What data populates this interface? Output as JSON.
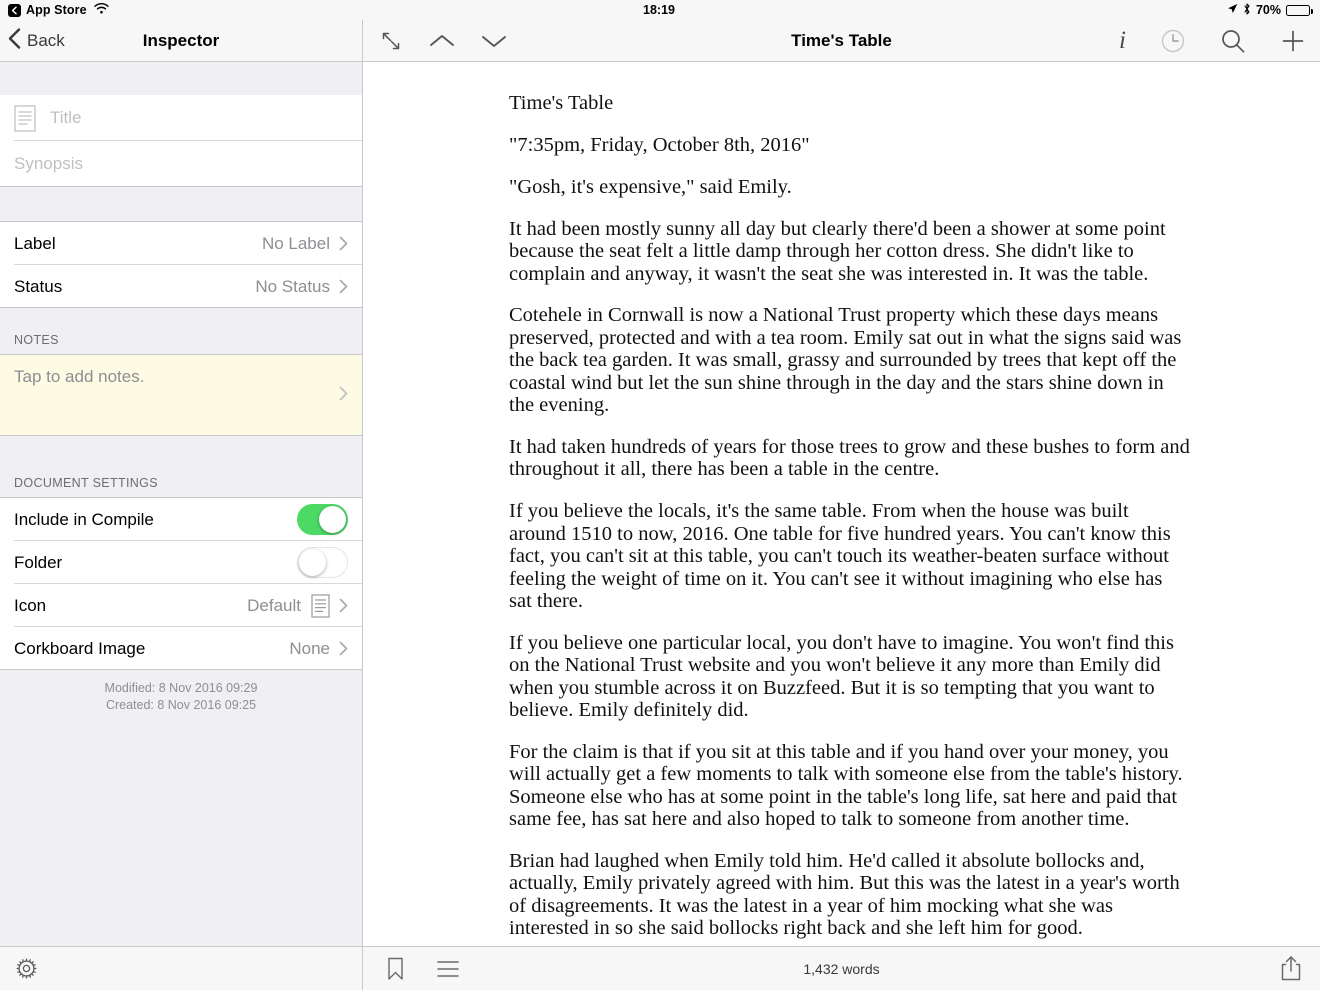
{
  "statusbar": {
    "back_app": "App Store",
    "wifi_icon": "wifi-icon",
    "time": "18:19",
    "location_icon": "location-arrow-icon",
    "bluetooth_icon": "bluetooth-icon",
    "battery_percent": "70%",
    "battery_level": 70
  },
  "sidebar": {
    "nav": {
      "back_label": "Back",
      "title": "Inspector"
    },
    "title_field": {
      "placeholder": "Title",
      "value": "",
      "icon": "document-lines-icon"
    },
    "synopsis_field": {
      "placeholder": "Synopsis",
      "value": ""
    },
    "meta_rows": [
      {
        "label": "Label",
        "value": "No Label"
      },
      {
        "label": "Status",
        "value": "No Status"
      }
    ],
    "notes": {
      "header": "NOTES",
      "placeholder": "Tap to add notes."
    },
    "document_settings": {
      "header": "DOCUMENT SETTINGS",
      "include_in_compile": {
        "label": "Include in Compile",
        "on": true
      },
      "folder": {
        "label": "Folder",
        "on": false
      },
      "icon_row": {
        "label": "Icon",
        "value": "Default",
        "icon": "document-lines-icon"
      },
      "corkboard_row": {
        "label": "Corkboard Image",
        "value": "None"
      }
    },
    "footer": {
      "modified": "Modified: 8 Nov 2016  09:29",
      "created": "Created: 8 Nov 2016  09:25"
    },
    "toolbar": {
      "settings_icon": "gear-icon"
    }
  },
  "main": {
    "nav": {
      "title": "Time's Table",
      "left_icons": [
        "expand-arrows-icon",
        "chevron-up-icon",
        "chevron-down-icon"
      ],
      "right_icons": [
        "info-italic-i-icon",
        "history-clock-icon",
        "search-icon",
        "add-plus-icon"
      ]
    },
    "document": {
      "paragraphs": [
        "Time's Table",
        "\"7:35pm, Friday, October 8th, 2016\"",
        "\"Gosh, it's expensive,\" said Emily.",
        "It had been mostly sunny all day but clearly there'd been a shower at some point because the seat felt a little damp through her cotton dress. She didn't like to complain and anyway, it wasn't the seat she was interested in. It was the table.",
        "Cotehele in Cornwall is now a National Trust property which these days means preserved, protected and with a tea room. Emily sat out in what the signs said was the back tea garden. It was small, grassy and surrounded by trees that kept off the coastal wind but let the sun shine through in the day and the stars shine down in the evening.",
        "It had taken hundreds of years for those trees to grow and these bushes to form and throughout it all, there has been a table in the centre.",
        "If you believe the locals, it's the same table. From when the house was built around 1510 to now, 2016. One table for five hundred years. You can't know this fact, you can't sit at this table, you can't touch its weather-beaten surface without feeling the weight of time on it. You can't see it without imagining who else has sat there.",
        "If you believe one particular local, you don't have to imagine. You won't find this on the National Trust website and you won't believe it any more than Emily did when you stumble across it on Buzzfeed. But it is so tempting that you want to believe. Emily definitely did.",
        "For the claim is that if you sit at this table and if you hand over your money, you will actually get a few moments to talk with someone else from the table's history. Someone else who has at some point in the table's long life, sat here and paid that same fee, has sat here and also hoped to talk to someone from another time.",
        "Brian had laughed when Emily told him. He'd called it absolute bollocks and, actually, Emily privately agreed with him. But this was the latest in a year's worth of disagreements. It was the latest in a year of him mocking what she was interested in so she said bollocks right back and she left him for good."
      ]
    },
    "toolbar": {
      "bookmark_icon": "bookmark-icon",
      "list_icon": "hamburger-list-icon",
      "word_count": "1,432 words",
      "share_icon": "share-icon"
    }
  },
  "colors": {
    "toggle_on": "#4CD964",
    "chrome": "#F7F7F7",
    "group_bg": "#EFEFF4",
    "notes_bg": "#FDFBE4",
    "separator": "#C8C7CC"
  }
}
